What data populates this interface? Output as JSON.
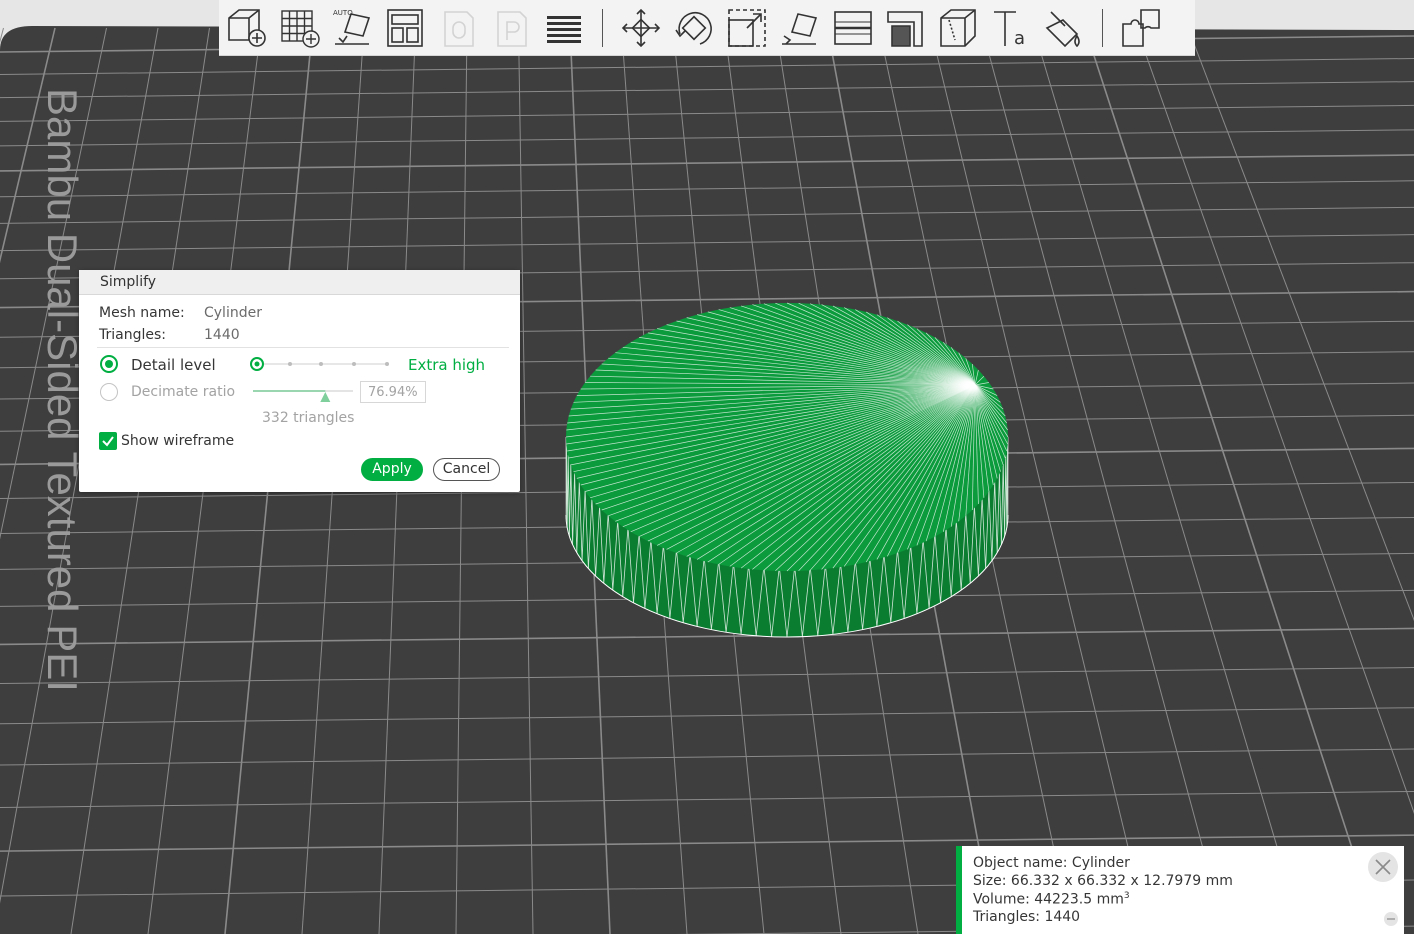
{
  "bed_label": "Bambu Dual-Sided Textured PEI",
  "toolbar": {
    "buttons": [
      {
        "name": "add-object",
        "icon": "cube-plus-icon",
        "enabled": true
      },
      {
        "name": "add-plate",
        "icon": "grid-plus-icon",
        "enabled": true
      },
      {
        "name": "auto-orient",
        "icon": "auto-orient-icon",
        "enabled": true
      },
      {
        "name": "arrange",
        "icon": "arrange-icon",
        "enabled": true
      },
      {
        "name": "split-to-objects",
        "icon": "split-objects-icon",
        "enabled": false
      },
      {
        "name": "split-to-parts",
        "icon": "split-parts-icon",
        "enabled": false
      },
      {
        "name": "layers-editing",
        "icon": "layers-icon",
        "enabled": true
      },
      {
        "name": "move",
        "icon": "move-arrows-icon",
        "enabled": true
      },
      {
        "name": "rotate",
        "icon": "rotate-icon",
        "enabled": true
      },
      {
        "name": "scale",
        "icon": "scale-icon",
        "enabled": true
      },
      {
        "name": "lay-on-face",
        "icon": "lay-on-face-icon",
        "enabled": true
      },
      {
        "name": "cut",
        "icon": "cut-icon",
        "enabled": true
      },
      {
        "name": "support-painting",
        "icon": "support-paint-icon",
        "enabled": true
      },
      {
        "name": "seam-painting",
        "icon": "seam-paint-icon",
        "enabled": true
      },
      {
        "name": "text",
        "icon": "text-icon",
        "enabled": true
      },
      {
        "name": "color-painting",
        "icon": "color-paint-icon",
        "enabled": true
      },
      {
        "name": "assembly",
        "icon": "assembly-icon",
        "enabled": true
      }
    ]
  },
  "simplify": {
    "title": "Simplify",
    "mesh_name_label": "Mesh name:",
    "mesh_name_value": "Cylinder",
    "triangles_label": "Triangles:",
    "triangles_value": "1440",
    "detail_level_label": "Detail level",
    "detail_level_selected": true,
    "detail_level_value": "Extra high",
    "detail_level_steps": 5,
    "detail_level_index": 0,
    "decimate_label": "Decimate ratio",
    "decimate_selected": false,
    "decimate_value": "76.94%",
    "decimate_fraction": 0.7694,
    "result_triangles": "332 triangles",
    "show_wireframe_label": "Show wireframe",
    "show_wireframe_checked": true,
    "apply_label": "Apply",
    "cancel_label": "Cancel"
  },
  "object_info": {
    "name_line": "Object name: Cylinder",
    "size_line": "Size: 66.332 x 66.332 x 12.7979 mm",
    "volume_line": "Volume: 44223.5 mm",
    "volume_unit_sup": "3",
    "triangles_line": "Triangles: 1440"
  },
  "colors": {
    "accent": "#00ae42",
    "bed": "#3e3e3e",
    "grid": "#8a8a8a",
    "model": "#0b9a3c"
  }
}
